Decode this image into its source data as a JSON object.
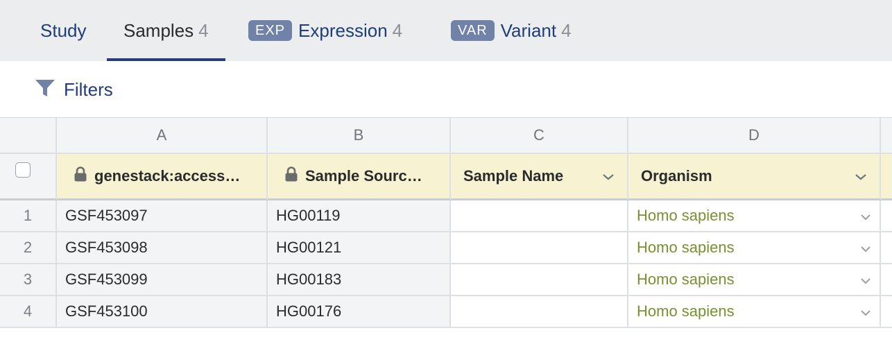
{
  "tabs": [
    {
      "label": "Study",
      "count": ""
    },
    {
      "label": "Samples",
      "count": "4"
    },
    {
      "badge": "EXP",
      "label": "Expression",
      "count": "4"
    },
    {
      "badge": "VAR",
      "label": "Variant",
      "count": "4"
    }
  ],
  "active_tab": "Samples",
  "filters": {
    "label": "Filters",
    "icon": "funnel-icon"
  },
  "table": {
    "column_letters": [
      "A",
      "B",
      "C",
      "D"
    ],
    "headers": [
      {
        "label": "genestack:access…",
        "locked": true
      },
      {
        "label": "Sample Sourc…",
        "locked": true
      },
      {
        "label": "Sample Name",
        "locked": false
      },
      {
        "label": "Organism",
        "locked": false
      }
    ],
    "rows": [
      {
        "index": "1",
        "accession": "GSF453097",
        "source": "HG00119",
        "name": "",
        "organism": "Homo sapiens"
      },
      {
        "index": "2",
        "accession": "GSF453098",
        "source": "HG00121",
        "name": "",
        "organism": "Homo sapiens"
      },
      {
        "index": "3",
        "accession": "GSF453099",
        "source": "HG00183",
        "name": "",
        "organism": "Homo sapiens"
      },
      {
        "index": "4",
        "accession": "GSF453100",
        "source": "HG00176",
        "name": "",
        "organism": "Homo sapiens"
      }
    ]
  },
  "colors": {
    "tab_bar_bg": "#ebedef",
    "link_blue": "#1f3d7a",
    "active_underline": "#243d78",
    "badge_bg": "#7082a8",
    "header_bg": "#f7f3d2",
    "organism_green": "#77912f"
  }
}
